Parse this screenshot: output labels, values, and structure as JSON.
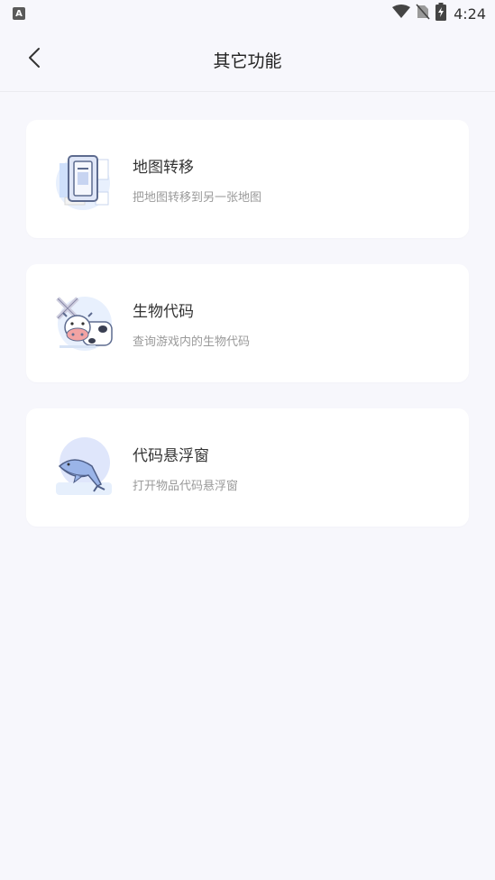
{
  "status_bar": {
    "app_badge": "A",
    "time": "4:24",
    "icons": [
      "wifi-icon",
      "no-sim-icon",
      "battery-charging-icon"
    ]
  },
  "header": {
    "title": "其它功能",
    "back_icon": "chevron-left-icon"
  },
  "cards": [
    {
      "title": "地图转移",
      "subtitle": "把地图转移到另一张地图",
      "icon": "map-transfer-icon"
    },
    {
      "title": "生物代码",
      "subtitle": "查询游戏内的生物代码",
      "icon": "cow-icon"
    },
    {
      "title": "代码悬浮窗",
      "subtitle": "打开物品代码悬浮窗",
      "icon": "whale-icon"
    }
  ],
  "colors": {
    "background": "#f7f7fc",
    "card": "#ffffff",
    "accent_blue": "#cfe0fb"
  }
}
